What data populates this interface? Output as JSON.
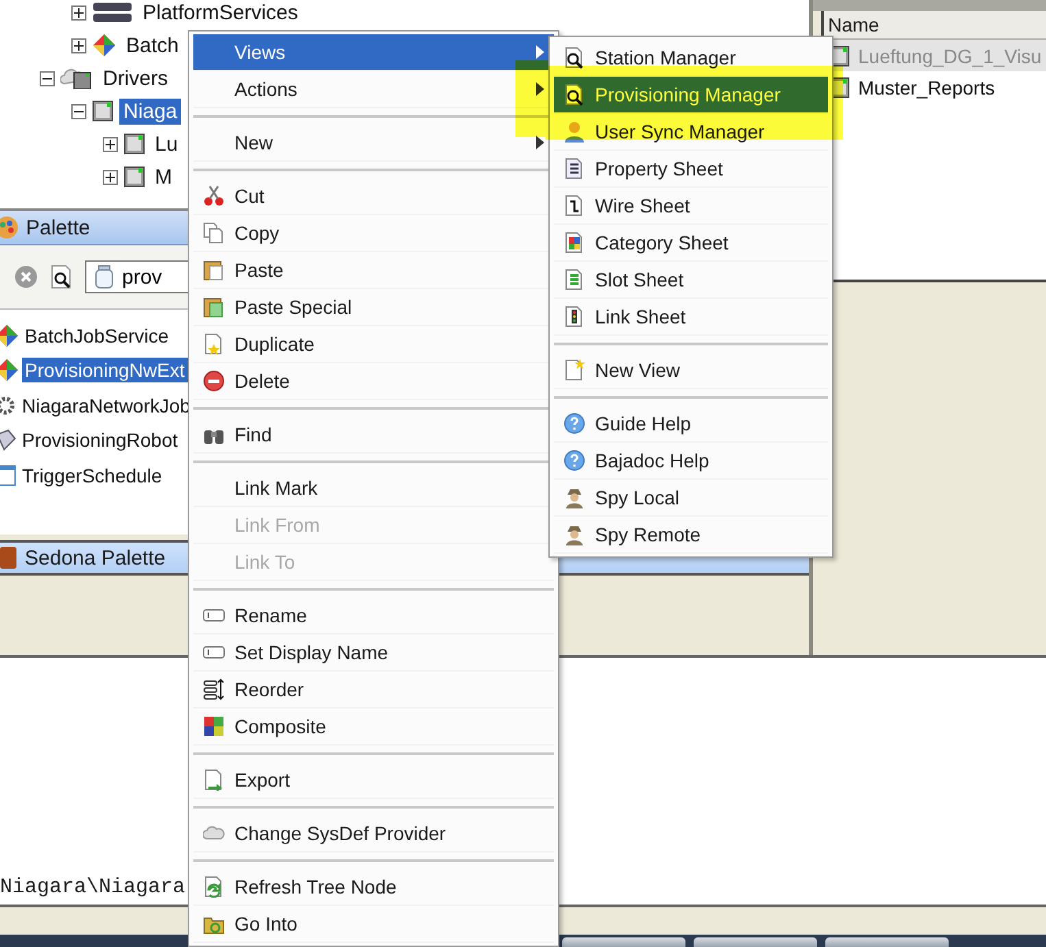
{
  "tree": {
    "continued_rows": [
      {
        "label": "PlatformServices",
        "expanded": false
      },
      {
        "label": "Batch",
        "expanded": false
      }
    ],
    "items": [
      {
        "label": "Drivers",
        "expanded": true,
        "selected": false,
        "children": [
          {
            "label": "Niaga",
            "expanded": true,
            "selected": true,
            "children": [
              {
                "label": "Lu",
                "expanded": false,
                "selected": false
              },
              {
                "label": "M",
                "expanded": false,
                "selected": false
              }
            ]
          }
        ]
      }
    ]
  },
  "palette": {
    "title": "Palette",
    "search": {
      "value": "prov"
    },
    "items": [
      {
        "label": "BatchJobService",
        "selected": false
      },
      {
        "label": "ProvisioningNwExt",
        "selected": true
      },
      {
        "label": "NiagaraNetworkJob",
        "selected": false
      },
      {
        "label": "ProvisioningRobot",
        "selected": false
      },
      {
        "label": "TriggerSchedule",
        "selected": false
      }
    ],
    "sedona_header": "Sedona Palette"
  },
  "table": {
    "columns": [
      "Name"
    ],
    "rows": [
      {
        "name": "Lueftung_DG_1_Visu",
        "selected": true
      },
      {
        "name": "Muster_Reports",
        "selected": false
      }
    ]
  },
  "console": {
    "text": "Niagara\\Niagara"
  },
  "context_menu": {
    "items": [
      {
        "kind": "item",
        "label": "Views",
        "submenu": true,
        "selected": true,
        "disabled": false
      },
      {
        "kind": "item",
        "label": "Actions",
        "submenu": true,
        "selected": false,
        "disabled": false
      },
      {
        "kind": "separator"
      },
      {
        "kind": "item",
        "label": "New",
        "submenu": true,
        "selected": false,
        "disabled": false
      },
      {
        "kind": "separator"
      },
      {
        "kind": "item",
        "label": "Cut",
        "submenu": false,
        "selected": false,
        "disabled": false
      },
      {
        "kind": "item",
        "label": "Copy",
        "submenu": false,
        "selected": false,
        "disabled": false
      },
      {
        "kind": "item",
        "label": "Paste",
        "submenu": false,
        "selected": false,
        "disabled": false
      },
      {
        "kind": "item",
        "label": "Paste Special",
        "submenu": false,
        "selected": false,
        "disabled": false
      },
      {
        "kind": "item",
        "label": "Duplicate",
        "submenu": false,
        "selected": false,
        "disabled": false
      },
      {
        "kind": "item",
        "label": "Delete",
        "submenu": false,
        "selected": false,
        "disabled": false
      },
      {
        "kind": "separator"
      },
      {
        "kind": "item",
        "label": "Find",
        "submenu": false,
        "selected": false,
        "disabled": false
      },
      {
        "kind": "separator"
      },
      {
        "kind": "item",
        "label": "Link Mark",
        "submenu": false,
        "selected": false,
        "disabled": false
      },
      {
        "kind": "item",
        "label": "Link From",
        "submenu": false,
        "selected": false,
        "disabled": true
      },
      {
        "kind": "item",
        "label": "Link To",
        "submenu": false,
        "selected": false,
        "disabled": true
      },
      {
        "kind": "separator"
      },
      {
        "kind": "item",
        "label": "Rename",
        "submenu": false,
        "selected": false,
        "disabled": false
      },
      {
        "kind": "item",
        "label": "Set Display Name",
        "submenu": false,
        "selected": false,
        "disabled": false
      },
      {
        "kind": "item",
        "label": "Reorder",
        "submenu": false,
        "selected": false,
        "disabled": false
      },
      {
        "kind": "item",
        "label": "Composite",
        "submenu": false,
        "selected": false,
        "disabled": false
      },
      {
        "kind": "separator"
      },
      {
        "kind": "item",
        "label": "Export",
        "submenu": false,
        "selected": false,
        "disabled": false
      },
      {
        "kind": "separator"
      },
      {
        "kind": "item",
        "label": "Change SysDef Provider",
        "submenu": false,
        "selected": false,
        "disabled": false
      },
      {
        "kind": "separator"
      },
      {
        "kind": "item",
        "label": "Refresh Tree Node",
        "submenu": false,
        "selected": false,
        "disabled": false
      },
      {
        "kind": "item",
        "label": "Go Into",
        "submenu": false,
        "selected": false,
        "disabled": false
      }
    ]
  },
  "views_submenu": {
    "items": [
      {
        "kind": "item",
        "label": "Station Manager",
        "selected": false
      },
      {
        "kind": "item",
        "label": "Provisioning Manager",
        "selected": true
      },
      {
        "kind": "item",
        "label": "User Sync Manager",
        "selected": false
      },
      {
        "kind": "item",
        "label": "Property Sheet",
        "selected": false
      },
      {
        "kind": "item",
        "label": "Wire Sheet",
        "selected": false
      },
      {
        "kind": "item",
        "label": "Category Sheet",
        "selected": false
      },
      {
        "kind": "item",
        "label": "Slot Sheet",
        "selected": false
      },
      {
        "kind": "item",
        "label": "Link Sheet",
        "selected": false
      },
      {
        "kind": "separator"
      },
      {
        "kind": "item",
        "label": "New View",
        "selected": false
      },
      {
        "kind": "separator"
      },
      {
        "kind": "item",
        "label": "Guide Help",
        "selected": false
      },
      {
        "kind": "item",
        "label": "Bajadoc Help",
        "selected": false
      },
      {
        "kind": "item",
        "label": "Spy Local",
        "selected": false
      },
      {
        "kind": "item",
        "label": "Spy Remote",
        "selected": false
      }
    ]
  }
}
